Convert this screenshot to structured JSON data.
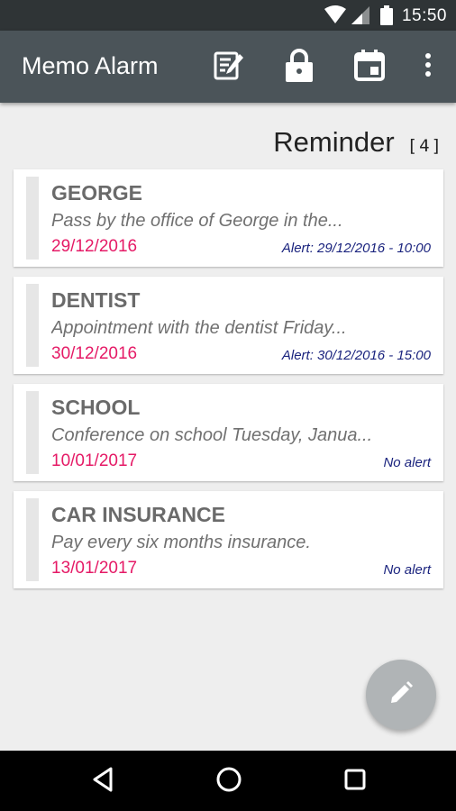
{
  "status_bar": {
    "time": "15:50",
    "icons": [
      "wifi-icon",
      "signal-icon",
      "battery-icon"
    ]
  },
  "app_bar": {
    "title": "Memo Alarm",
    "actions": [
      "edit-note-icon",
      "lock-icon",
      "calendar-icon",
      "more-vert-icon"
    ]
  },
  "section": {
    "title": "Reminder",
    "count": "[4]"
  },
  "memos": [
    {
      "title": "GEORGE",
      "description": "Pass by the office of George in the...",
      "date": "29/12/2016",
      "alert": "Alert: 29/12/2016 - 10:00"
    },
    {
      "title": "DENTIST",
      "description": "Appointment with the dentist Friday...",
      "date": "30/12/2016",
      "alert": "Alert: 30/12/2016 - 15:00"
    },
    {
      "title": "SCHOOL",
      "description": "Conference on school Tuesday, Janua...",
      "date": "10/01/2017",
      "alert": "No alert"
    },
    {
      "title": "CAR INSURANCE",
      "description": "Pay every six months insurance.",
      "date": "13/01/2017",
      "alert": "No alert"
    }
  ],
  "fab": {
    "icon": "pencil-icon"
  },
  "nav_bar": {
    "icons": [
      "back-icon",
      "home-icon",
      "recents-icon"
    ]
  },
  "colors": {
    "app_bar": "#4b5459",
    "date": "#e51a66",
    "alert": "#1a237e",
    "fab": "#b0b4b6"
  }
}
